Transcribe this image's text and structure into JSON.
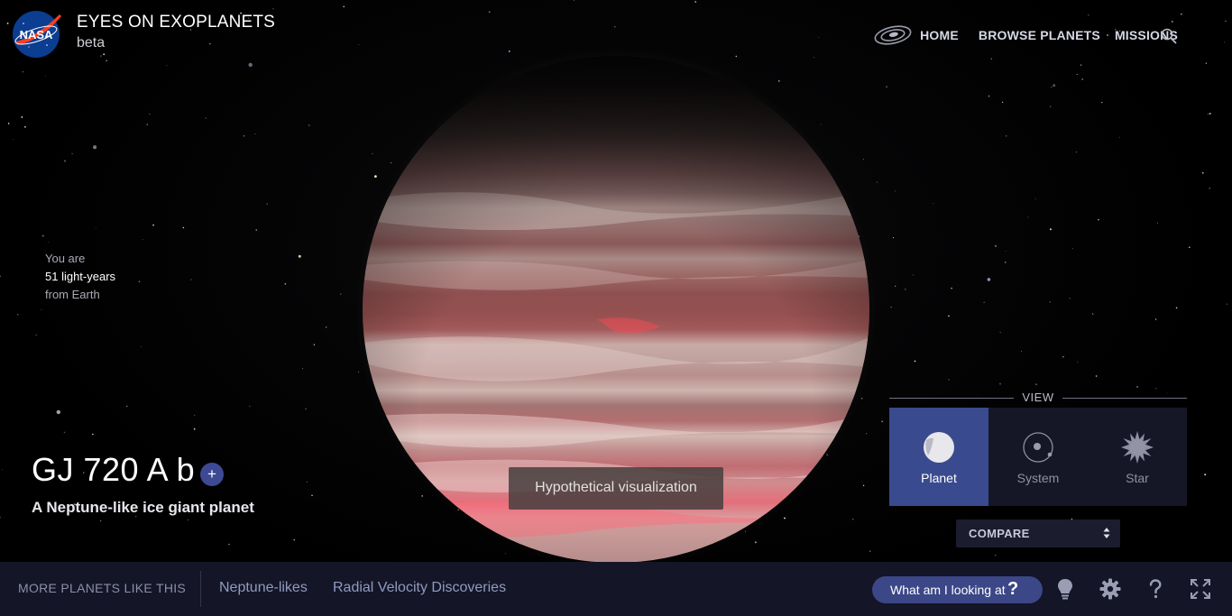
{
  "header": {
    "agency_logo_text": "NASA",
    "app_title": "EYES ON EXOPLANETS",
    "app_subtitle": "beta",
    "nav": [
      {
        "label": "HOME"
      },
      {
        "label": "BROWSE PLANETS"
      },
      {
        "label": "MISSIONS"
      }
    ],
    "icons": {
      "galaxy": "galaxy-icon",
      "search": "search-icon"
    }
  },
  "distance": {
    "line1": "You are",
    "line2": "51 light-years",
    "line3": "from Earth"
  },
  "planet": {
    "name": "GJ 720 A b",
    "add_label": "+",
    "description": "A Neptune-like ice giant planet",
    "visualization_note": "Hypothetical visualization"
  },
  "view": {
    "label": "VIEW",
    "options": [
      {
        "label": "Planet",
        "icon": "planet-icon",
        "active": true
      },
      {
        "label": "System",
        "icon": "system-icon",
        "active": false
      },
      {
        "label": "Star",
        "icon": "star-icon",
        "active": false
      }
    ]
  },
  "compare": {
    "selected": "COMPARE"
  },
  "bottom_bar": {
    "more_label": "MORE PLANETS LIKE THIS",
    "tags": [
      {
        "label": "Neptune-likes"
      },
      {
        "label": "Radial Velocity Discoveries"
      }
    ],
    "what_label": "What am I looking at",
    "what_icon": "?",
    "icons": [
      "lightbulb-icon",
      "gear-icon",
      "help-icon",
      "fullscreen-icon"
    ]
  },
  "colors": {
    "accent": "#3a4a8e",
    "bar_bg": "#141527",
    "panel_bg": "#161726",
    "nasa_blue": "#0b3d91",
    "nasa_red": "#fc3d21"
  }
}
